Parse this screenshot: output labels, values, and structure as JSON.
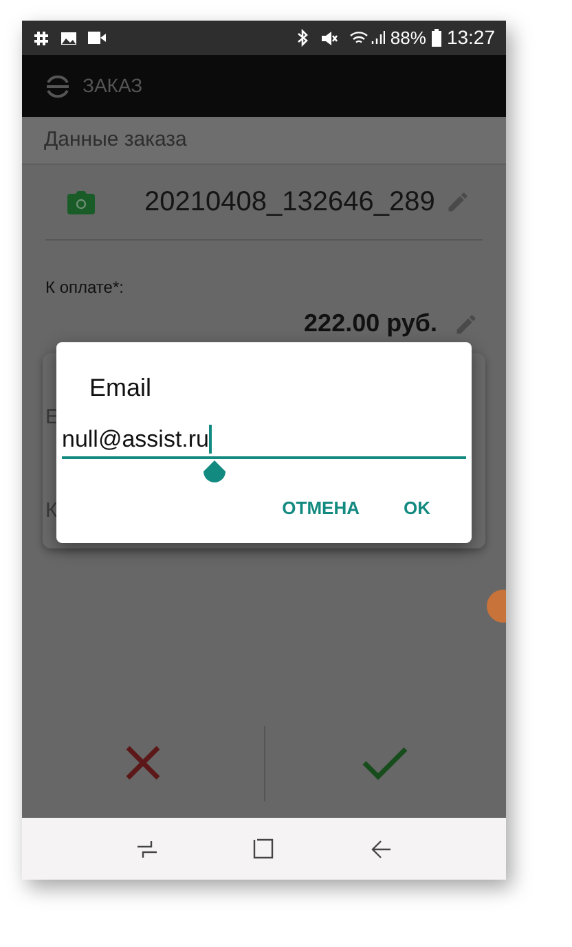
{
  "status_bar": {
    "battery": "88%",
    "time": "13:27"
  },
  "app_bar": {
    "title": "ЗАКАЗ"
  },
  "section": {
    "title": "Данные заказа"
  },
  "order": {
    "file_name": "20210408_132646_289",
    "amount_label": "К оплате*:",
    "amount": "222.00 руб.",
    "covered_labels": [
      "E",
      "К"
    ]
  },
  "dialog": {
    "title": "Email",
    "value": "null@assist.ru",
    "buttons": [
      "ОТМЕНА",
      "OK"
    ]
  }
}
